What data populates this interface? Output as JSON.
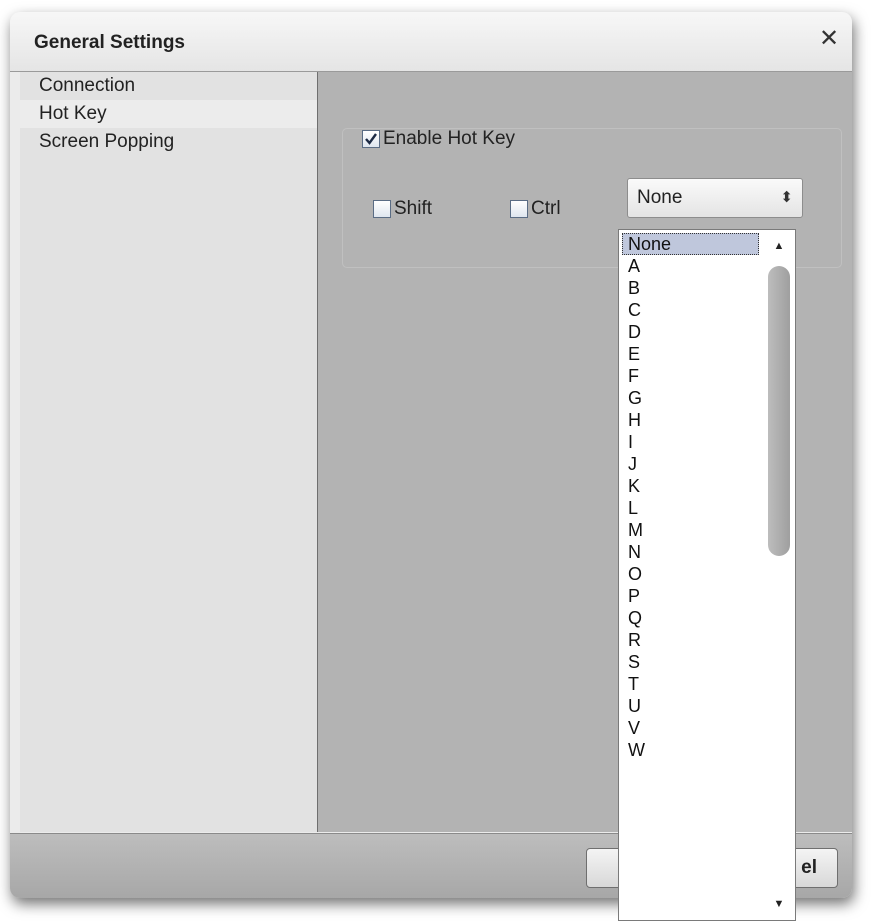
{
  "dialog": {
    "title": "General Settings",
    "close_glyph": "✕"
  },
  "sidebar": {
    "items": [
      {
        "label": "Connection"
      },
      {
        "label": "Hot Key",
        "active": true
      },
      {
        "label": "Screen Popping"
      }
    ]
  },
  "hotkey": {
    "enable_label": "Enable Hot Key",
    "enable_checked": true,
    "shift_label": "Shift",
    "shift_checked": false,
    "ctrl_label": "Ctrl",
    "ctrl_checked": false,
    "key_select_value": "None"
  },
  "dropdown": {
    "options": [
      "None",
      "A",
      "B",
      "C",
      "D",
      "E",
      "F",
      "G",
      "H",
      "I",
      "J",
      "K",
      "L",
      "M",
      "N",
      "O",
      "P",
      "Q",
      "R",
      "S",
      "T",
      "U",
      "V",
      "W"
    ],
    "selected": "None"
  },
  "footer": {
    "cancel_partial_label": "el"
  },
  "icons": {
    "close": "close-icon",
    "select_arrows": "updown-arrows-icon",
    "scroll_up": "scroll-up-icon",
    "scroll_down": "scroll-down-icon",
    "checkmark": "checkmark-icon"
  }
}
